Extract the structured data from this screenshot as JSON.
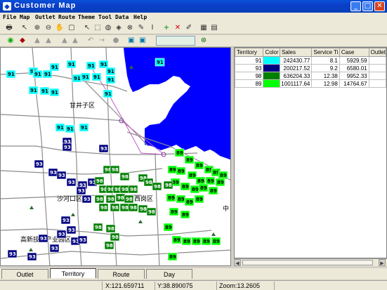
{
  "window": {
    "title": "Customer Map",
    "min": "_",
    "max": "□",
    "close": "✕"
  },
  "menu": [
    "File",
    "Map",
    "Outlet",
    "Route",
    "Theme",
    "Tool",
    "Data",
    "Help"
  ],
  "toolbar1_icons": [
    "print-icon",
    "cursor-icon",
    "zoom-in-icon",
    "zoom-out-icon",
    "pan-icon",
    "extent-icon",
    "select-icon",
    "select-rect-icon",
    "select-radius-icon",
    "select-region-icon",
    "clear-icon",
    "ruler-icon",
    "label-icon",
    "add-icon",
    "delete-icon",
    "edit-icon",
    "layer-icon",
    "legend-icon"
  ],
  "toolbar2_icons": [
    "globe-icon",
    "layers-icon",
    "home-icon",
    "prev-icon",
    "next-icon",
    "refresh-icon",
    "zoom-combo-icon",
    "find-icon"
  ],
  "table": {
    "headers": [
      "Territory",
      "Color",
      "Sales",
      "Service Ti",
      "Case",
      "Outlet"
    ],
    "rows": [
      {
        "territory": "91",
        "color": "#00ffff",
        "sales": "242430.77",
        "service": "8.1",
        "case": "5929.59",
        "outlet": ""
      },
      {
        "territory": "93",
        "color": "#000080",
        "sales": "200217.52",
        "service": "9.2",
        "case": "6580.01",
        "outlet": ""
      },
      {
        "territory": "98",
        "color": "#008000",
        "sales": "636204.33",
        "service": "12.38",
        "case": "9952.33",
        "outlet": ""
      },
      {
        "territory": "89",
        "color": "#00ff00",
        "sales": "1001117.64",
        "service": "12.98",
        "case": "14764.67",
        "outlet": ""
      }
    ]
  },
  "map": {
    "places": [
      "甘井子区",
      "沙河口区",
      "西岗区",
      "高新技术产业园区",
      "中"
    ],
    "territory_colors": {
      "91": "#00ffff",
      "93": "#000080",
      "98": "#008000",
      "89": "#00ff00"
    }
  },
  "tabs": [
    "Outlet",
    "Territory",
    "Route",
    "Day"
  ],
  "active_tab": "Territory",
  "status": {
    "x": "X:121.659711",
    "y": "Y:38.890075",
    "zoom": "Zoom:13.2605"
  }
}
